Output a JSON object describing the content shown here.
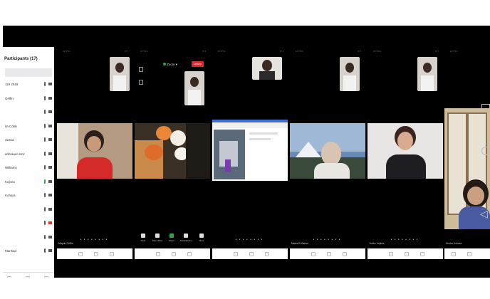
{
  "panel": {
    "title": "Participants (17)",
    "rows": [
      {
        "name": "119 2018",
        "cam": "normal"
      },
      {
        "name": "Griffin",
        "cam": "normal"
      },
      {
        "name": "",
        "cam": "normal"
      },
      {
        "name": "ita Cobb",
        "cam": "normal"
      },
      {
        "name": "awson",
        "cam": "normal"
      },
      {
        "name": "anbrauer-lenz",
        "cam": "normal"
      },
      {
        "name": "Williams",
        "cam": "normal"
      },
      {
        "name": "Kojima",
        "cam": "normal"
      },
      {
        "name": "Kohara",
        "cam": "normal"
      },
      {
        "name": "",
        "cam": "normal"
      },
      {
        "name": "",
        "cam": "red"
      },
      {
        "name": "",
        "cam": "normal"
      },
      {
        "name": "Mankad",
        "cam": "normal"
      }
    ]
  },
  "toolbar": {
    "mute": "Mute",
    "stop_video": "Stop Video",
    "share": "Share",
    "participants": "Participants",
    "more": "More"
  },
  "header": {
    "zoom_label": "Zoom",
    "leave_label": "Leave"
  },
  "speakers": [
    "Mayde Griffin",
    "",
    "",
    "Nadia El Barad",
    "Yuriko Kojima",
    "Shoko Kohara"
  ],
  "colors": {
    "red": "#e02828",
    "green": "#2ea44f",
    "panel_bg": "#ffffff",
    "stage_bg": "#000000"
  }
}
